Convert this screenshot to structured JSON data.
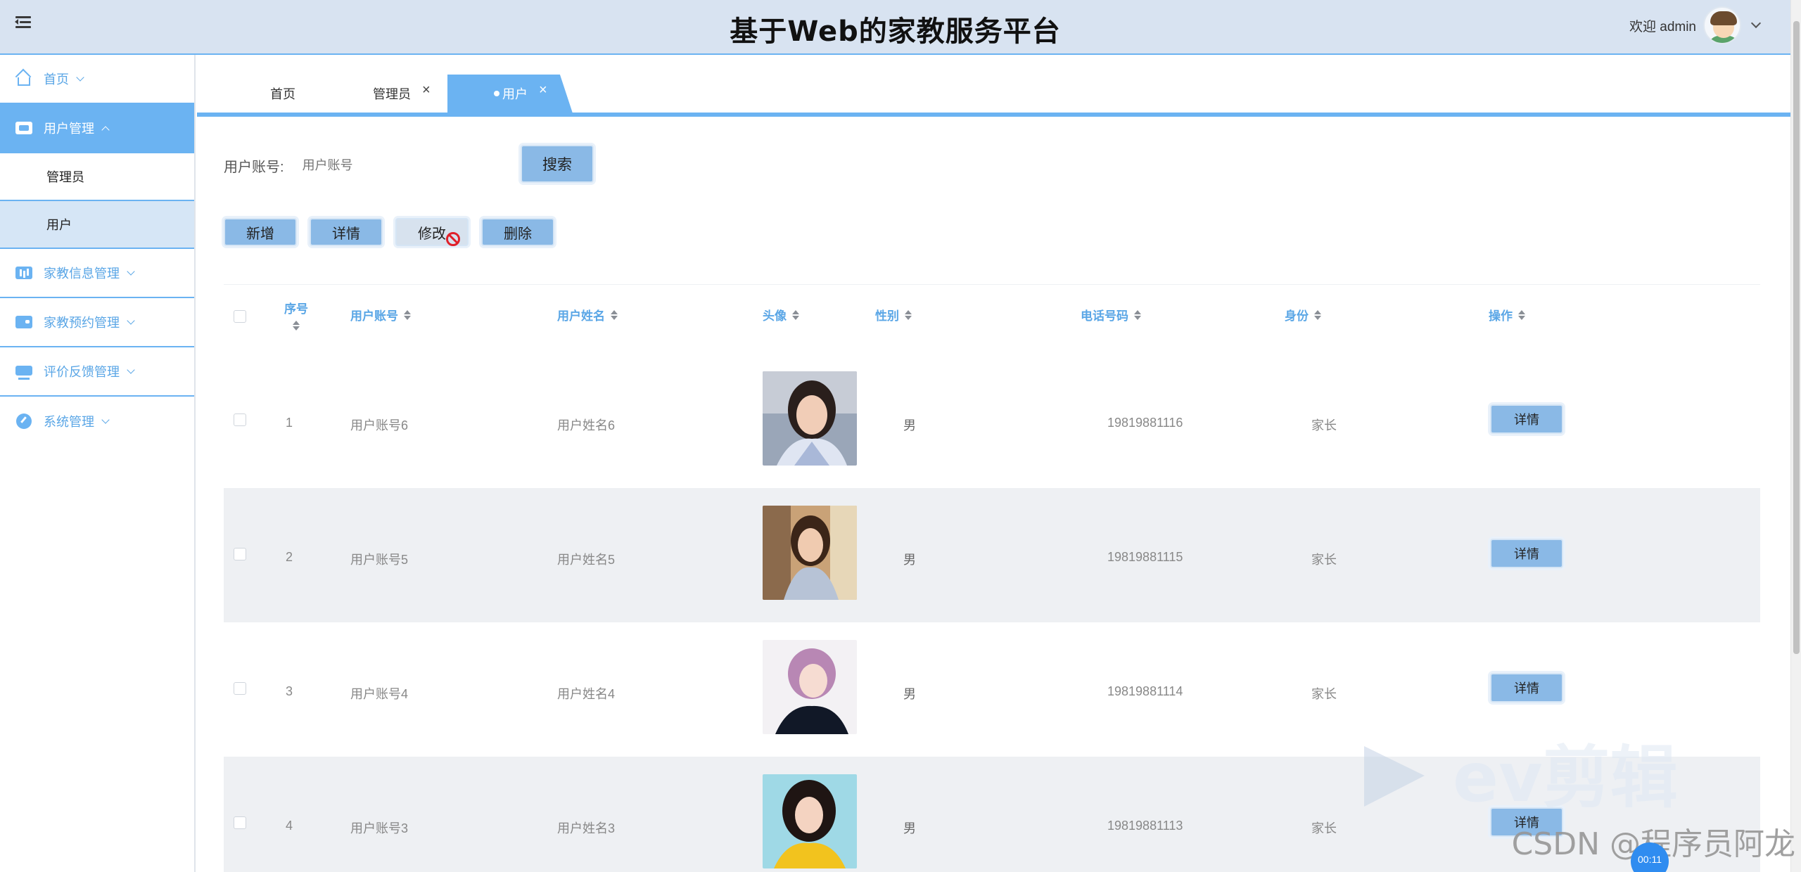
{
  "header": {
    "title": "基于Web的家教服务平台",
    "welcome": "欢迎 admin"
  },
  "sidebar": {
    "items": [
      {
        "label": "首页",
        "icon": "home-icon"
      },
      {
        "label": "用户管理",
        "icon": "user-card-icon",
        "active": true
      },
      {
        "label": "家教信息管理",
        "icon": "info-chart-icon"
      },
      {
        "label": "家教预约管理",
        "icon": "wallet-icon"
      },
      {
        "label": "评价反馈管理",
        "icon": "monitor-icon"
      },
      {
        "label": "系统管理",
        "icon": "gauge-icon"
      }
    ],
    "subitems": [
      {
        "label": "管理员"
      },
      {
        "label": "用户",
        "active": true
      }
    ]
  },
  "tabs": [
    {
      "label": "首页"
    },
    {
      "label": "管理员",
      "close": "×"
    },
    {
      "label": "用户",
      "close": "×",
      "active": true
    }
  ],
  "search": {
    "label": "用户账号:",
    "placeholder": "用户账号",
    "button": "搜索"
  },
  "actions": {
    "add": "新增",
    "detail": "详情",
    "edit": "修改",
    "delete": "删除"
  },
  "table": {
    "columns": [
      "序号",
      "用户账号",
      "用户姓名",
      "头像",
      "性别",
      "电话号码",
      "身份",
      "操作"
    ],
    "rows": [
      {
        "index": "1",
        "account": "用户账号6",
        "name": "用户姓名6",
        "gender": "男",
        "phone": "19819881116",
        "role": "家长",
        "action": "详情"
      },
      {
        "index": "2",
        "account": "用户账号5",
        "name": "用户姓名5",
        "gender": "男",
        "phone": "19819881115",
        "role": "家长",
        "action": "详情"
      },
      {
        "index": "3",
        "account": "用户账号4",
        "name": "用户姓名4",
        "gender": "男",
        "phone": "19819881114",
        "role": "家长",
        "action": "详情"
      },
      {
        "index": "4",
        "account": "用户账号3",
        "name": "用户姓名3",
        "gender": "男",
        "phone": "19819881113",
        "role": "家长",
        "action": "详情"
      }
    ]
  },
  "overlay": {
    "csdn": "CSDN @程序员阿龙",
    "ev": "ev剪辑",
    "recorder": "00:11"
  },
  "colors": {
    "accent": "#6bb3f2",
    "header_bg": "#d8e3f1",
    "button": "#8ab9e6"
  }
}
